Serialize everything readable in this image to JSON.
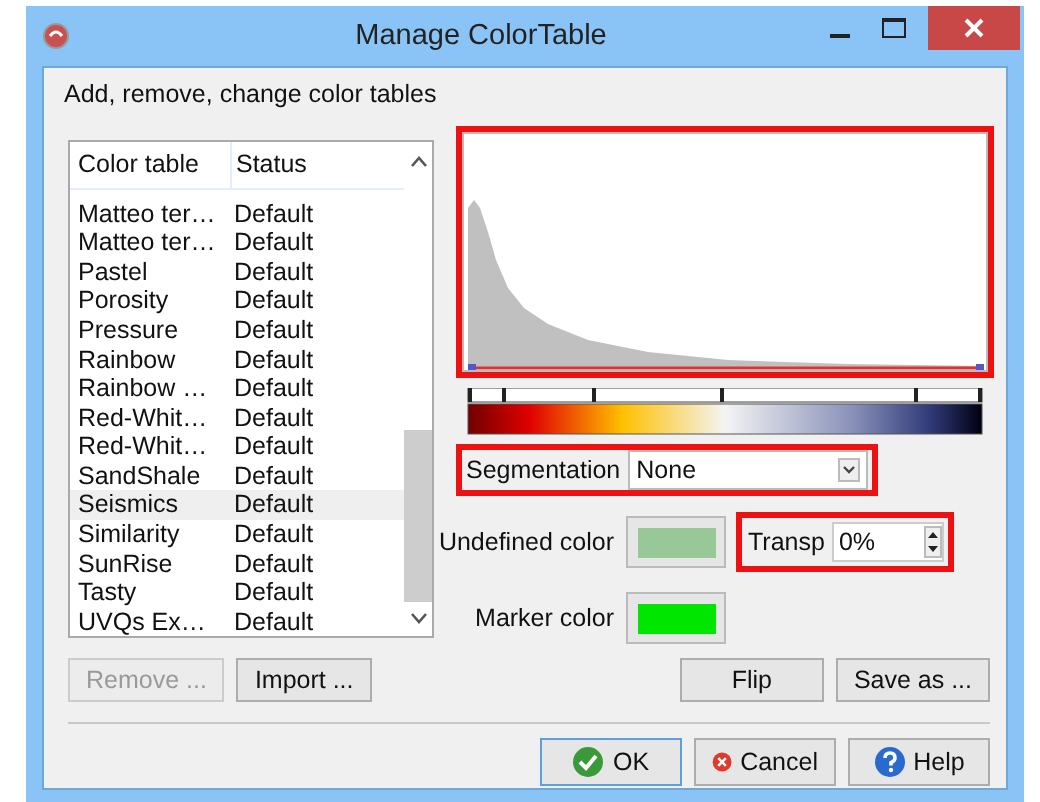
{
  "window": {
    "title": "Manage ColorTable"
  },
  "description": "Add, remove, change color tables",
  "table": {
    "columns": [
      "Color table",
      "Status"
    ],
    "rows": [
      {
        "name": "Matteo ter…",
        "status": "Default",
        "selected": false
      },
      {
        "name": "Matteo ter…",
        "status": "Default",
        "selected": false
      },
      {
        "name": "Pastel",
        "status": "Default",
        "selected": false
      },
      {
        "name": "Porosity",
        "status": "Default",
        "selected": false
      },
      {
        "name": "Pressure",
        "status": "Default",
        "selected": false
      },
      {
        "name": "Rainbow",
        "status": "Default",
        "selected": false
      },
      {
        "name": "Rainbow …",
        "status": "Default",
        "selected": false
      },
      {
        "name": "Red-Whit…",
        "status": "Default",
        "selected": false
      },
      {
        "name": "Red-Whit…",
        "status": "Default",
        "selected": false
      },
      {
        "name": "SandShale",
        "status": "Default",
        "selected": false
      },
      {
        "name": "Seismics",
        "status": "Default",
        "selected": true
      },
      {
        "name": "Similarity",
        "status": "Default",
        "selected": false
      },
      {
        "name": "SunRise",
        "status": "Default",
        "selected": false
      },
      {
        "name": "Tasty",
        "status": "Default",
        "selected": false
      },
      {
        "name": "UVQs Ex…",
        "status": "Default",
        "selected": false
      }
    ]
  },
  "histogram": {
    "highlighted": true
  },
  "segmentation": {
    "label": "Segmentation",
    "value": "None",
    "highlighted": true
  },
  "undefined_color": {
    "label": "Undefined color",
    "color": "#98c898"
  },
  "transparency": {
    "label": "Transp",
    "value": "0%",
    "highlighted": true
  },
  "marker_color": {
    "label": "Marker color",
    "color": "#00e600"
  },
  "table_buttons": [
    {
      "label": "Remove ...",
      "disabled": true
    },
    {
      "label": "Import ...",
      "disabled": false
    }
  ],
  "edit_buttons": [
    {
      "label": "Flip",
      "disabled": false
    },
    {
      "label": "Save as ...",
      "disabled": false
    }
  ],
  "dialog_buttons": [
    {
      "label": "OK",
      "kind": "ok"
    },
    {
      "label": "Cancel",
      "kind": "cancel"
    },
    {
      "label": "Help",
      "kind": "help"
    }
  ]
}
